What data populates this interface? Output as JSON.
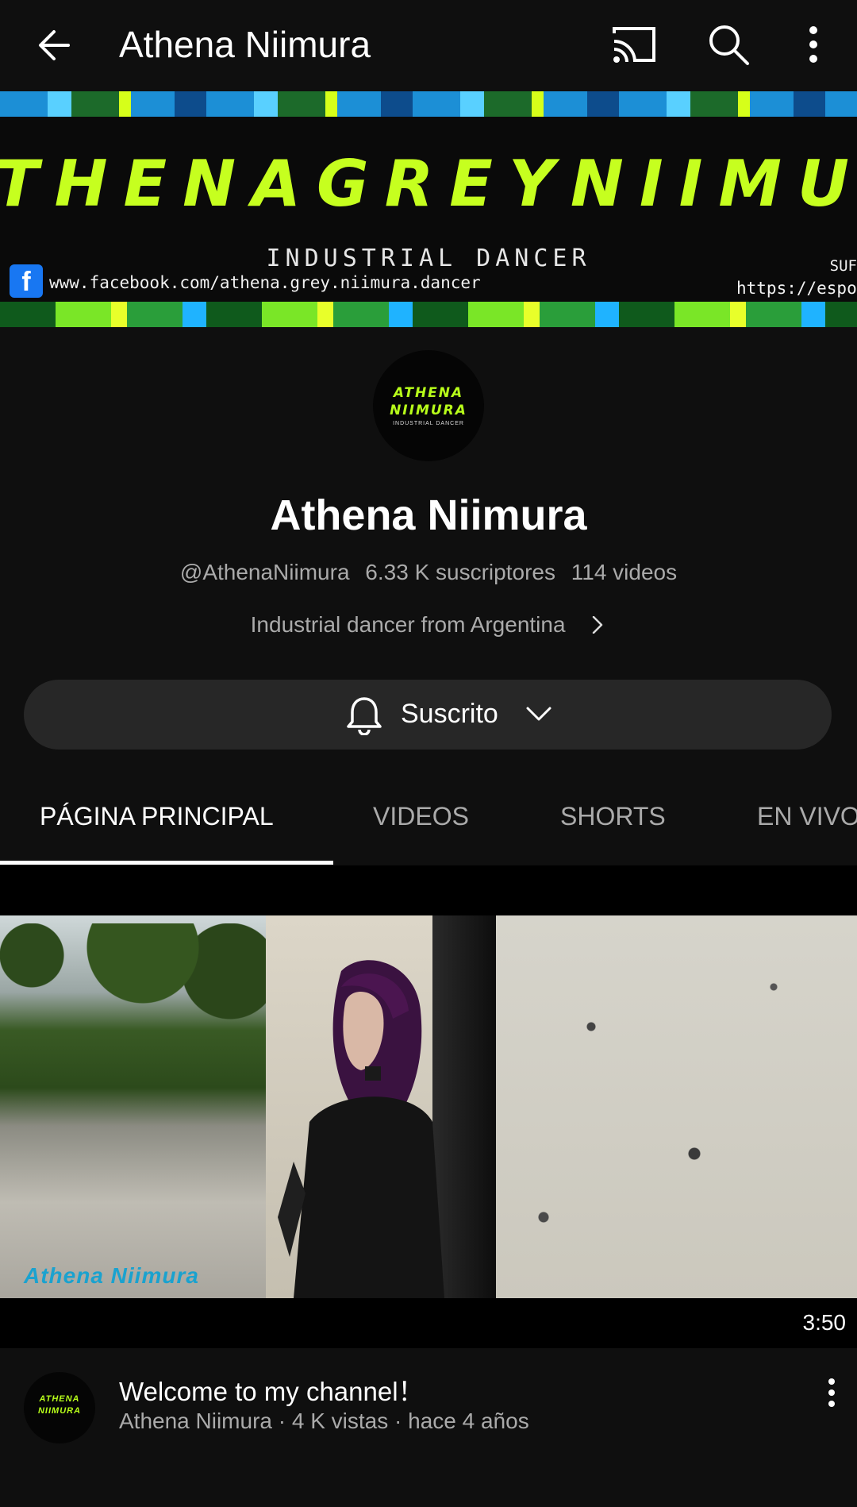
{
  "header": {
    "title": "Athena Niimura",
    "icons": [
      "arrow-left-icon",
      "cast-icon",
      "search-icon",
      "more-vert-icon"
    ]
  },
  "banner": {
    "brand_text": "THENAGREYNIIMU",
    "subtitle": "INDUSTRIAL DANCER",
    "facebook_url": "www.facebook.com/athena.grey.niimura.dancer",
    "right_label": "SUF",
    "right_url": "https://espon"
  },
  "avatar": {
    "line1": "ATHENA",
    "line2": "NIIMURA",
    "line3": "INDUSTRIAL DANCER"
  },
  "channel": {
    "name": "Athena Niimura",
    "handle": "@AthenaNiimura",
    "subscribers": "6.33 K suscriptores",
    "videos": "114 videos",
    "description": "Industrial dancer from Argentina"
  },
  "subscribe_button": {
    "label": "Suscrito"
  },
  "tabs": [
    {
      "label": "PÁGINA PRINCIPAL",
      "active": true
    },
    {
      "label": "VIDEOS",
      "active": false
    },
    {
      "label": "SHORTS",
      "active": false
    },
    {
      "label": "EN VIVO",
      "active": false
    }
  ],
  "featured_video": {
    "watermark": "Athena Niimura",
    "duration": "3:50",
    "title": "Welcome to my channel！",
    "meta": "Athena Niimura · 4 K vistas · hace 4 años"
  },
  "colors": {
    "background": "#0f0f0f",
    "accent_green": "#c6ff1f",
    "secondary_text": "#aaaaaa",
    "button_bg": "#272727"
  }
}
